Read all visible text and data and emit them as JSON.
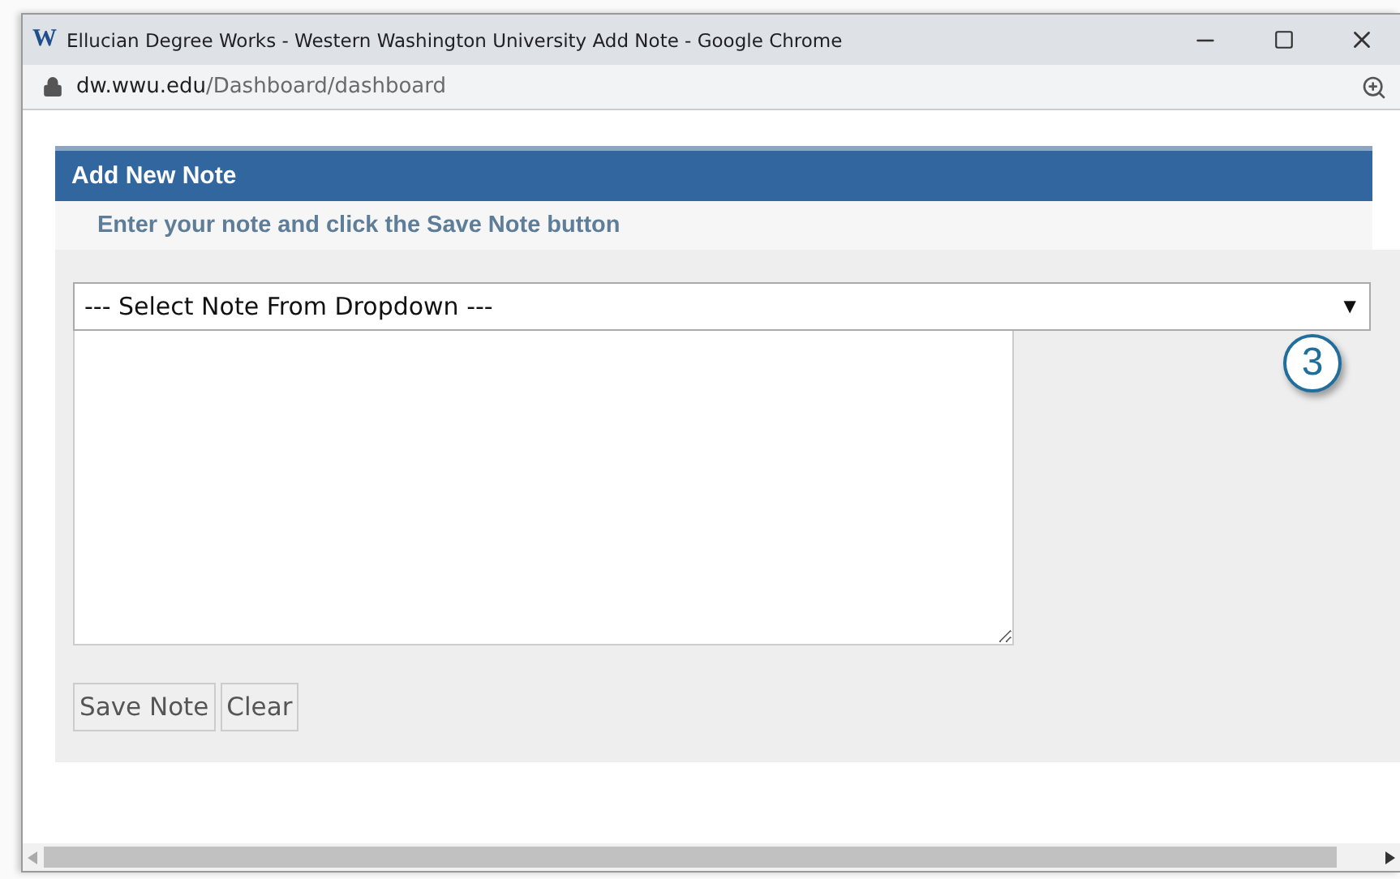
{
  "window": {
    "title": "Ellucian Degree Works - Western Washington University Add Note - Google Chrome",
    "logo": "W"
  },
  "address_bar": {
    "host": "dw.wwu.edu",
    "path": "/Dashboard/dashboard"
  },
  "panel": {
    "title": "Add New Note",
    "instruction": "Enter your note and click the Save Note button"
  },
  "note_select": {
    "value": "--- Select Note From Dropdown ---",
    "arrow": "▼"
  },
  "callout": "3",
  "buttons": [
    "Save Note",
    "Clear"
  ]
}
